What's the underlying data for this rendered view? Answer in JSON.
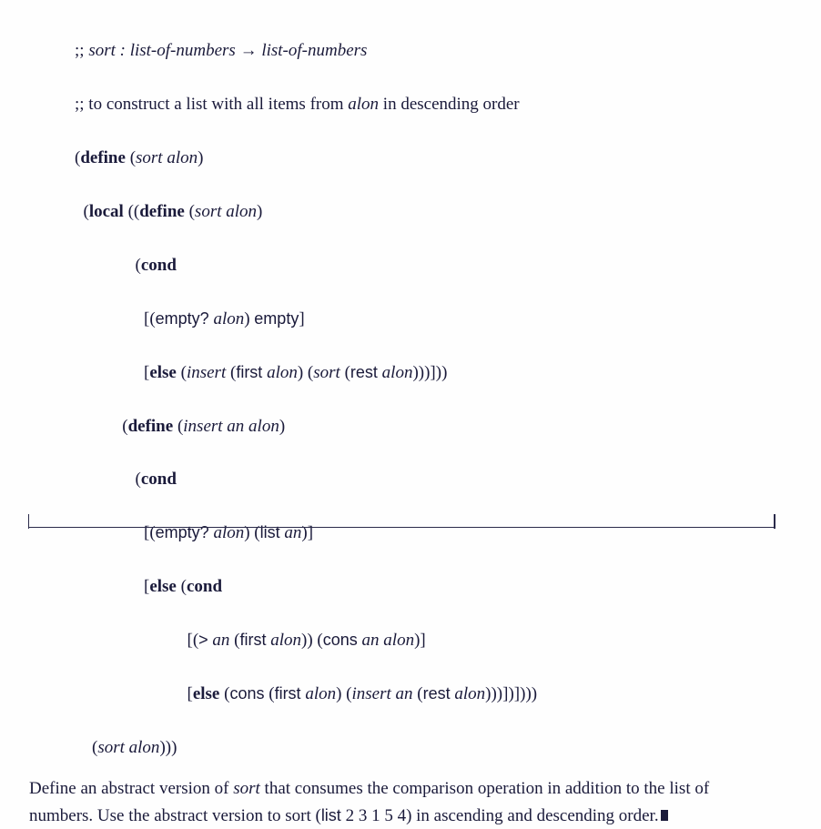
{
  "code": {
    "c01": ";; ",
    "c01b": "sort : list-of-numbers → list-of-numbers",
    "c02": ";; to construct a list with all items from ",
    "c02b": "alon",
    "c02c": " in descending order",
    "c03a": "(",
    "c03b": "define",
    "c03c": " (",
    "c03d": "sort alon",
    "c03e": ")",
    "c04a": "  (",
    "c04b": "local",
    "c04c": " ((",
    "c04d": "define",
    "c04e": " (",
    "c04f": "sort alon",
    "c04g": ")",
    "c05a": "              (",
    "c05b": "cond",
    "c06a": "                [(",
    "c06b": "empty?",
    "c06c": " ",
    "c06d": "alon",
    "c06e": ") ",
    "c06f": "empty",
    "c06g": "]",
    "c07a": "                [",
    "c07b": "else",
    "c07c": " (",
    "c07d": "insert",
    "c07e": " (",
    "c07f": "first",
    "c07g": " ",
    "c07h": "alon",
    "c07i": ") (",
    "c07j": "sort",
    "c07k": " (",
    "c07l": "rest",
    "c07m": " ",
    "c07n": "alon",
    "c07o": ")))]))",
    "c08a": "           (",
    "c08b": "define",
    "c08c": " (",
    "c08d": "insert an alon",
    "c08e": ")",
    "c09a": "              (",
    "c09b": "cond",
    "c10a": "                [(",
    "c10b": "empty?",
    "c10c": " ",
    "c10d": "alon",
    "c10e": ") (",
    "c10f": "list",
    "c10g": " ",
    "c10h": "an",
    "c10i": ")]",
    "c11a": "                [",
    "c11b": "else",
    "c11c": " (",
    "c11d": "cond",
    "c12a": "                          [(",
    "c12b": ">",
    "c12c": " ",
    "c12d": "an",
    "c12e": " (",
    "c12f": "first",
    "c12g": " ",
    "c12h": "alon",
    "c12i": ")) (",
    "c12j": "cons",
    "c12k": " ",
    "c12l": "an alon",
    "c12m": ")]",
    "c13a": "                          [",
    "c13b": "else",
    "c13c": " (",
    "c13d": "cons",
    "c13e": " (",
    "c13f": "first",
    "c13g": " ",
    "c13h": "alon",
    "c13i": ") (",
    "c13j": "insert an",
    "c13k": " (",
    "c13l": "rest",
    "c13m": " ",
    "c13n": "alon",
    "c13o": ")))])])))",
    "c14a": "    (",
    "c14b": "sort alon",
    "c14c": ")))"
  },
  "para": {
    "t1": "Define an abstract version of ",
    "t2": "sort",
    "t3": " that consumes the comparison operation in addition to the list of numbers. Use the abstract version to sort (",
    "t4": "list",
    "t5": " 2 3 1 5 4) in ascending and descending order."
  }
}
